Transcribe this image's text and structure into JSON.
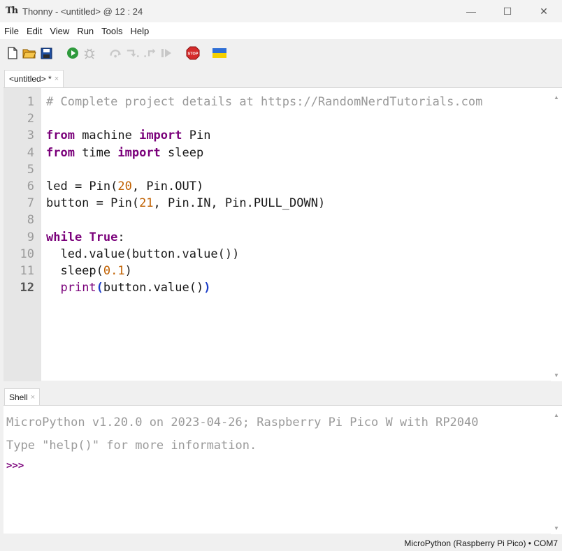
{
  "window": {
    "title": "Thonny  -  <untitled>  @  12 : 24",
    "app_icon": "Th",
    "minimize": "—",
    "maximize": "☐",
    "close": "✕"
  },
  "menu": [
    "File",
    "Edit",
    "View",
    "Run",
    "Tools",
    "Help"
  ],
  "toolbar": {
    "icons": [
      "new-file-icon",
      "open-folder-icon",
      "save-icon",
      "run-icon",
      "debug-icon",
      "step-over-icon",
      "step-into-icon",
      "step-out-icon",
      "resume-icon",
      "stop-icon",
      "ukraine-flag-icon"
    ],
    "stop_label": "STOP",
    "colors": {
      "run": "#2e9a3c",
      "stop": "#d52b2b",
      "flag_blue": "#2f6fd6",
      "flag_yellow": "#f5d000",
      "save": "#1f4fa0",
      "folder": "#e8a828"
    }
  },
  "editor": {
    "tab_label": "<untitled> *",
    "tab_close": "×",
    "line_numbers": [
      "1",
      "2",
      "3",
      "4",
      "5",
      "6",
      "7",
      "8",
      "9",
      "10",
      "11",
      "12"
    ],
    "current_line": "12",
    "lines": [
      [
        {
          "t": "# Complete project details at https://RandomNerdTutorials.com",
          "c": "comment"
        }
      ],
      [],
      [
        {
          "t": "from",
          "c": "kw"
        },
        {
          "t": " machine ",
          "c": ""
        },
        {
          "t": "import",
          "c": "kw"
        },
        {
          "t": " Pin",
          "c": ""
        }
      ],
      [
        {
          "t": "from",
          "c": "kw"
        },
        {
          "t": " time ",
          "c": ""
        },
        {
          "t": "import",
          "c": "kw"
        },
        {
          "t": " sleep",
          "c": ""
        }
      ],
      [],
      [
        {
          "t": "led = Pin(",
          "c": ""
        },
        {
          "t": "20",
          "c": "num"
        },
        {
          "t": ", Pin.OUT)",
          "c": ""
        }
      ],
      [
        {
          "t": "button = Pin(",
          "c": ""
        },
        {
          "t": "21",
          "c": "num"
        },
        {
          "t": ", Pin.IN, Pin.PULL_DOWN)",
          "c": ""
        }
      ],
      [],
      [
        {
          "t": "while",
          "c": "kw"
        },
        {
          "t": " ",
          "c": ""
        },
        {
          "t": "True",
          "c": "kw"
        },
        {
          "t": ":",
          "c": ""
        }
      ],
      [
        {
          "t": "  led.value(button.value())",
          "c": ""
        }
      ],
      [
        {
          "t": "  sleep(",
          "c": ""
        },
        {
          "t": "0.1",
          "c": "num"
        },
        {
          "t": ")",
          "c": ""
        }
      ],
      [
        {
          "t": "  ",
          "c": ""
        },
        {
          "t": "print",
          "c": "fn"
        },
        {
          "t": "(",
          "c": "paren"
        },
        {
          "t": "button.value()",
          "c": ""
        },
        {
          "t": ")",
          "c": "paren"
        }
      ]
    ]
  },
  "shell": {
    "tab_label": "Shell",
    "tab_close": "×",
    "banner": "MicroPython v1.20.0 on 2023-04-26; Raspberry Pi Pico W with RP2040",
    "help": "Type \"help()\" for more information.",
    "prompt": ">>>"
  },
  "statusbar": {
    "text": "MicroPython (Raspberry Pi Pico)  •  COM7"
  }
}
